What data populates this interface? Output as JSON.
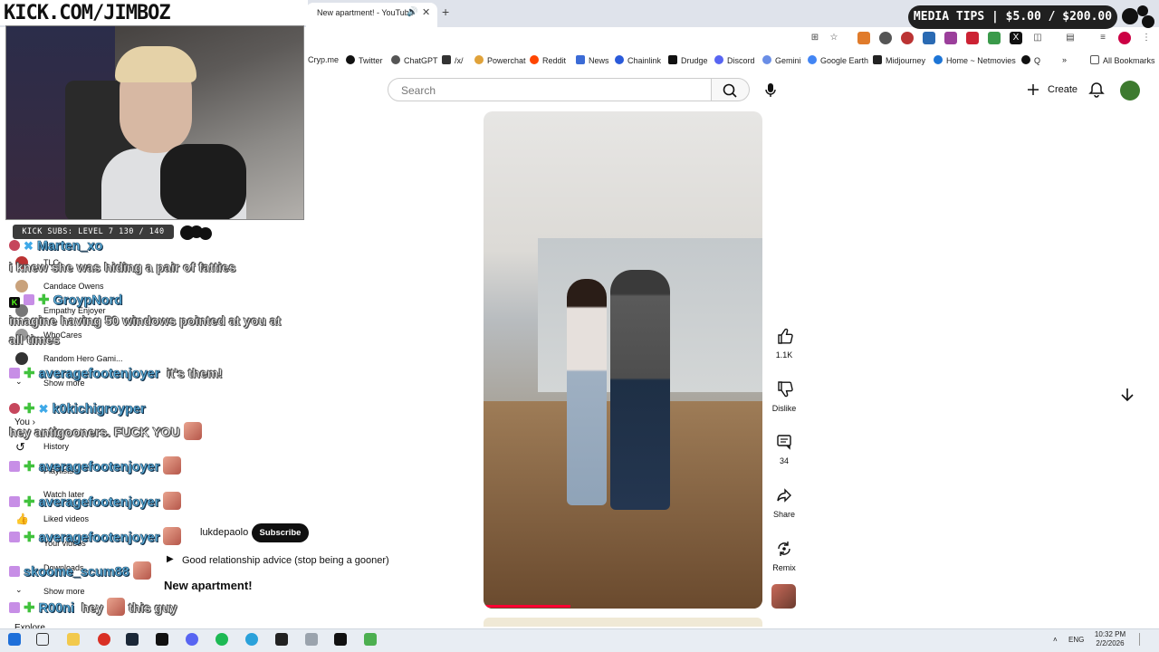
{
  "overlay": {
    "banner_text": "КІСК.СОМ/ЈІМВОZ",
    "subs_bar": "KICK SUBS: LEVEL 7 130 / 140",
    "media_tips": "MEDIA TIPS | $5.00 / $200.00"
  },
  "browser": {
    "active_tab_title": "New apartment! - YouTube",
    "bookmarks": [
      {
        "label": "Cryp.me"
      },
      {
        "label": "Twitter"
      },
      {
        "label": "ChatGPT"
      },
      {
        "label": "/x/"
      },
      {
        "label": "Powerchat"
      },
      {
        "label": "Reddit"
      },
      {
        "label": "News"
      },
      {
        "label": "Chainlink"
      },
      {
        "label": "Drudge"
      },
      {
        "label": "Discord"
      },
      {
        "label": "Gemini"
      },
      {
        "label": "Google Earth"
      },
      {
        "label": "Midjourney"
      },
      {
        "label": "Home ~ Netmovies"
      },
      {
        "label": "Q"
      },
      {
        "label": "All Bookmarks"
      }
    ]
  },
  "youtube": {
    "search_placeholder": "Search",
    "create_label": "Create",
    "likes": "1.1K",
    "dislike_label": "Dislike",
    "comments": "34",
    "share_label": "Share",
    "remix_label": "Remix",
    "channel": "lukdepaolo",
    "subscribe_label": "Subscribe",
    "description": "Good relationship advice (stop being a gooner)",
    "title": "New apartment!",
    "sidebar": [
      {
        "label": "TLC"
      },
      {
        "label": "Candace Owens"
      },
      {
        "label": "Empathy Enjoyer"
      },
      {
        "label": "WhoCares"
      },
      {
        "label": "Random Hero Gami..."
      },
      {
        "label": "Show more"
      },
      {
        "label": "You"
      },
      {
        "label": "History"
      },
      {
        "label": "Playlists"
      },
      {
        "label": "Watch later"
      },
      {
        "label": "Liked videos"
      },
      {
        "label": "Your videos"
      },
      {
        "label": "Downloads"
      },
      {
        "label": "Show more"
      },
      {
        "label": "Explore"
      }
    ]
  },
  "chat": [
    {
      "user": "Marten_xo",
      "message": ""
    },
    {
      "user": "",
      "message": "i knew she was hiding a pair of fatties"
    },
    {
      "user": "GroypNord",
      "message": ""
    },
    {
      "user": "",
      "message": "imagine having 50 windows pointed at you at"
    },
    {
      "user": "",
      "message": "all times"
    },
    {
      "user": "averagefootenjoyer",
      "message": "it's them!"
    },
    {
      "user": "k0kichigroyper",
      "message": ""
    },
    {
      "user": "",
      "message": "hey antigooners. FUCK YOU"
    },
    {
      "user": "averagefootenjoyer",
      "message": ""
    },
    {
      "user": "averagefootenjoyer",
      "message": ""
    },
    {
      "user": "averagefootenjoyer",
      "message": ""
    },
    {
      "user": "skoome_scum88",
      "message": ""
    },
    {
      "user": "R00ni",
      "message": "hey"
    },
    {
      "user": "",
      "message": "this guy"
    }
  ],
  "taskbar": {
    "lang": "ENG",
    "time": "10:32 PM",
    "date": "2/2/2026"
  },
  "icons": {
    "tab_close": "close-icon",
    "tab_new": "plus-icon",
    "search": "search-icon",
    "mic": "mic-icon",
    "bell": "bell-icon",
    "like": "thumbs-up-icon",
    "dislike": "thumbs-down-icon",
    "comments": "comment-icon",
    "share": "share-icon",
    "remix": "remix-icon",
    "down": "arrow-down-icon"
  }
}
